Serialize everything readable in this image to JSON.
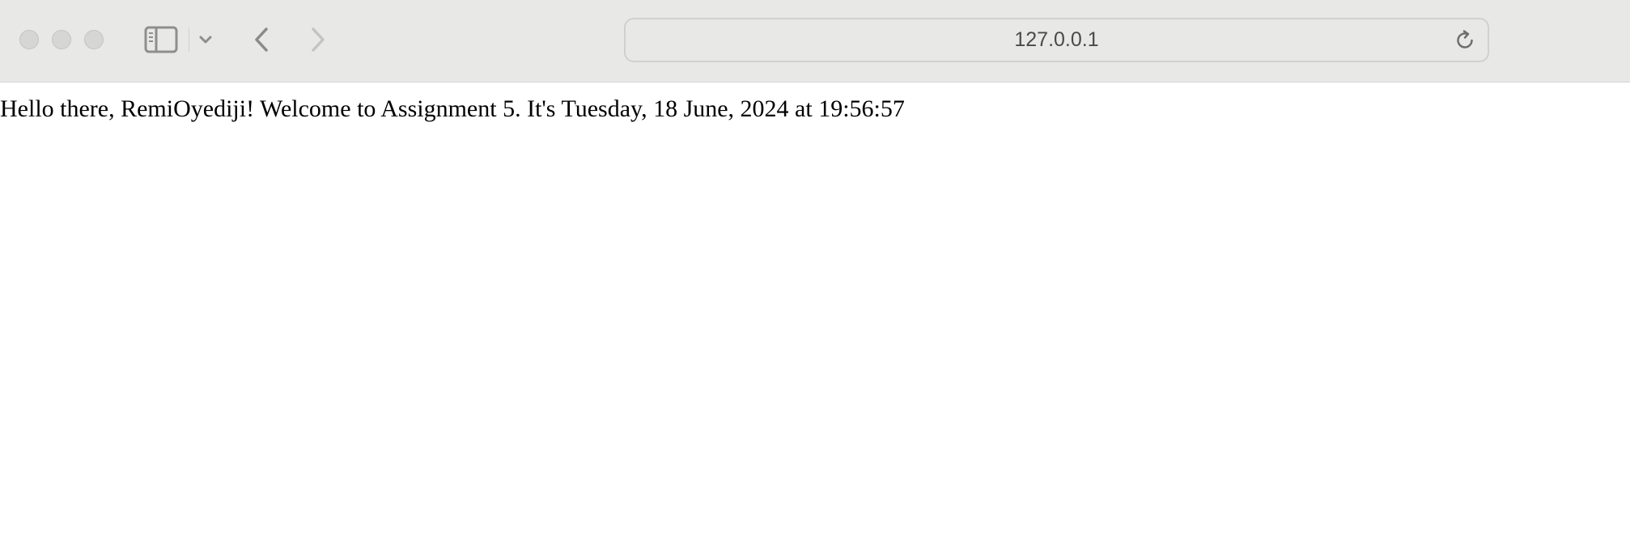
{
  "browser": {
    "address": "127.0.0.1",
    "icons": {
      "sidebar": "sidebar-toggle-icon",
      "tab_overview": "chevron-down-icon",
      "back": "chevron-left-icon",
      "forward": "chevron-right-icon",
      "reload": "reload-icon"
    },
    "colors": {
      "toolbar_bg": "#e8e8e6",
      "traffic_light": "#d6d6d4"
    }
  },
  "page": {
    "greeting": "Hello there, RemiOyediji! Welcome to Assignment 5. It's Tuesday, 18 June, 2024 at 19:56:57"
  }
}
